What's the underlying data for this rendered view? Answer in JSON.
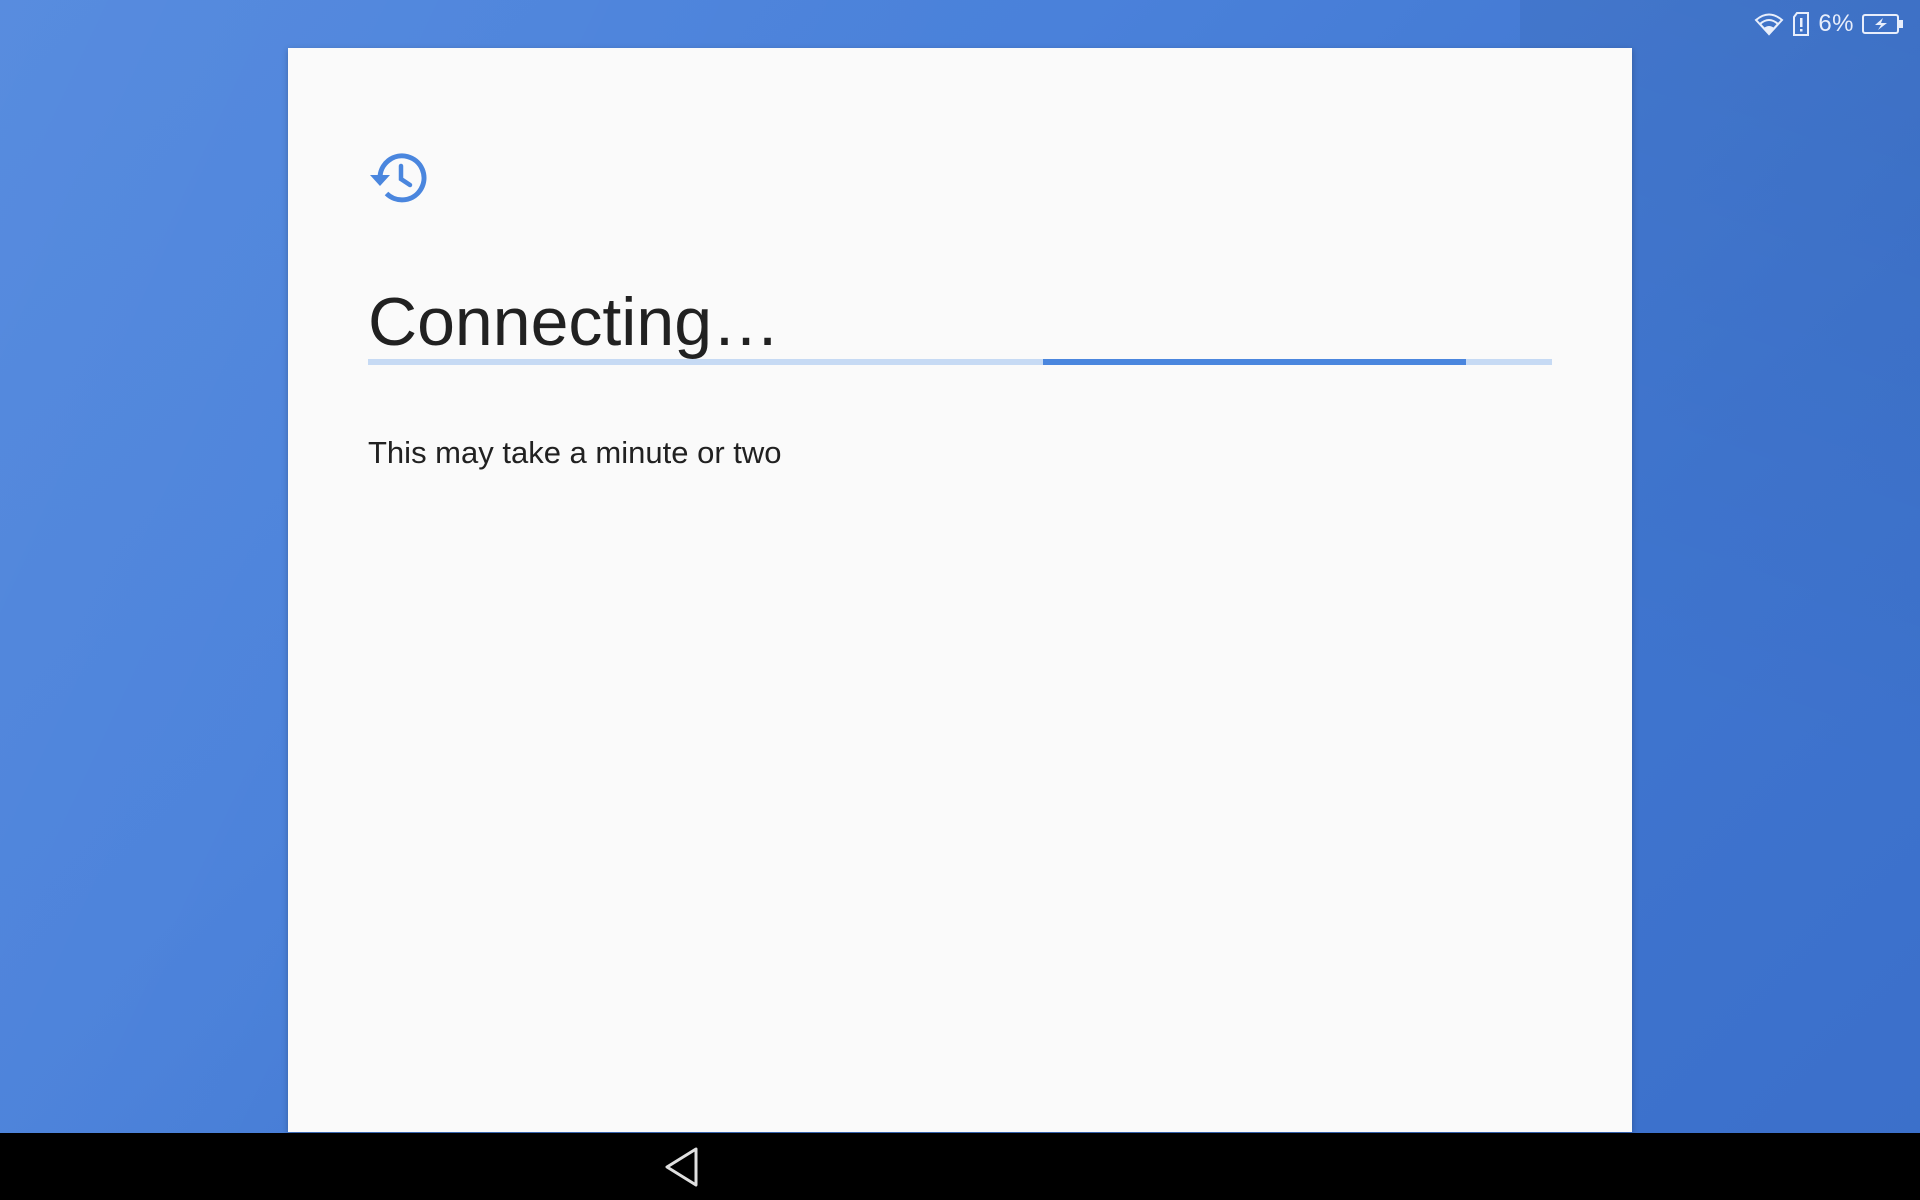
{
  "status_bar": {
    "battery_percent": "6%",
    "wifi_icon": "wifi-icon",
    "sd_icon": "sd-card-alert-icon",
    "battery_icon": "battery-charging-icon"
  },
  "card": {
    "icon": "restore-history-icon",
    "title": "Connecting…",
    "subtitle": "This may take a minute or two",
    "progress": {
      "indeterminate": true,
      "segment_start": 0.57,
      "segment_end": 0.927
    }
  },
  "nav_bar": {
    "back_icon": "back-triangle-icon"
  },
  "colors": {
    "background": "#4a81da",
    "card": "#fafafa",
    "accent": "#4a86de",
    "progress_track": "#c6daf4",
    "text": "#212121",
    "nav_bar": "#000000"
  }
}
